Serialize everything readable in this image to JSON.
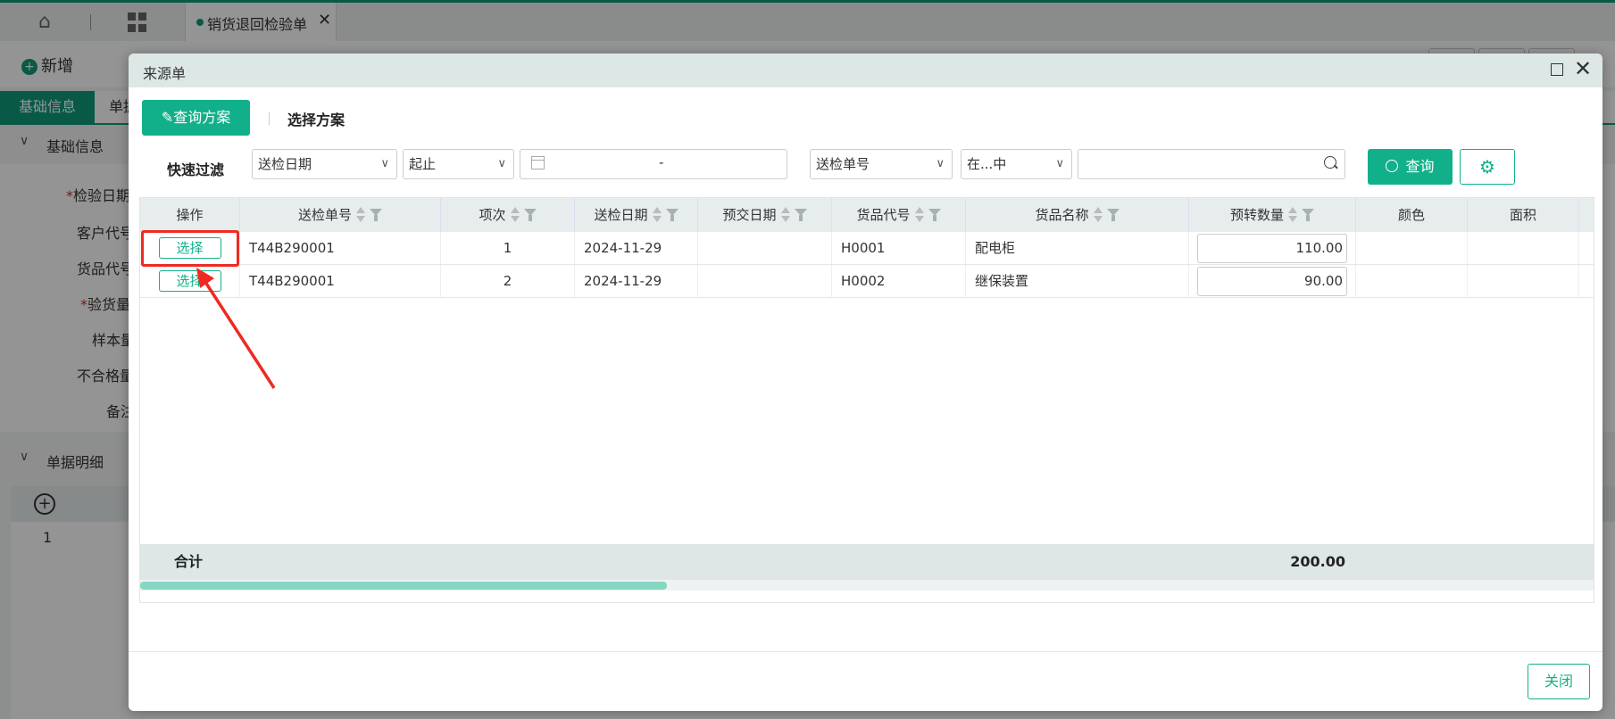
{
  "app": {
    "tab_title": "销货退回检验单",
    "new_button": "新增",
    "form_tabs": [
      "基础信息",
      "单据"
    ],
    "section_basic": "基础信息",
    "section_detail": "单据明细",
    "basic_fields": [
      "检验日期",
      "客户代号",
      "货品代号",
      "验货量",
      "样本量",
      "不合格量",
      "备注"
    ],
    "detail_row_no": "1"
  },
  "dialog": {
    "title": "来源单",
    "scheme_button": "查询方案",
    "scheme_select_label": "选择方案",
    "quick_filter_label": "快速过滤",
    "filter1_field": "送检日期",
    "filter1_op": "起止",
    "date_range_sep": "-",
    "filter2_field": "送检单号",
    "filter2_op": "在...中",
    "filter2_value": "",
    "query_button": "查询",
    "close_button": "关闭"
  },
  "table": {
    "columns": [
      "操作",
      "送检单号",
      "项次",
      "送检日期",
      "预交日期",
      "货品代号",
      "货品名称",
      "预转数量",
      "颜色",
      "面积"
    ],
    "select_label": "选择",
    "rows": [
      {
        "doc_no": "T44B290001",
        "seq": "1",
        "date": "2024-11-29",
        "due": "",
        "code": "H0001",
        "name": "配电柜",
        "qty": "110.00"
      },
      {
        "doc_no": "T44B290001",
        "seq": "2",
        "date": "2024-11-29",
        "due": "",
        "code": "H0002",
        "name": "继保装置",
        "qty": "90.00"
      }
    ],
    "total_label": "合计",
    "total_qty": "200.00"
  },
  "colors": {
    "accent": "#12b08a",
    "annotation": "#ee2a22"
  }
}
